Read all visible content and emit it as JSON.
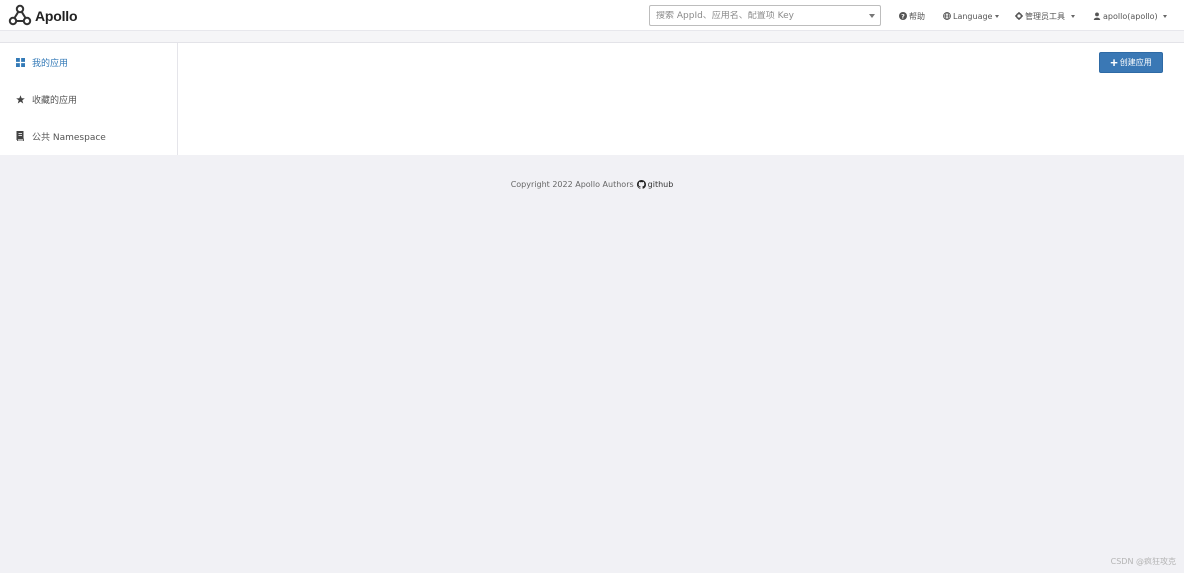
{
  "brand": {
    "name": "Apollo"
  },
  "search": {
    "placeholder": "搜索 AppId、应用名、配置项 Key",
    "value": ""
  },
  "nav": {
    "help": "帮助",
    "language": "Language",
    "admin_tools": "管理员工具",
    "user": "apollo(apollo)"
  },
  "sidebar": {
    "items": [
      {
        "label": "我的应用",
        "icon": "grid-icon",
        "active": true
      },
      {
        "label": "收藏的应用",
        "icon": "star-icon",
        "active": false
      },
      {
        "label": "公共 Namespace",
        "icon": "book-icon",
        "active": false
      }
    ]
  },
  "actions": {
    "create_app": "创建应用"
  },
  "footer": {
    "copyright": "Copyright 2022 Apollo Authors",
    "github": "github"
  },
  "watermark": "CSDN @疯狂攻克",
  "colors": {
    "accent": "#3a78b5",
    "active_link": "#337ab7",
    "background": "#f1f1f5"
  }
}
